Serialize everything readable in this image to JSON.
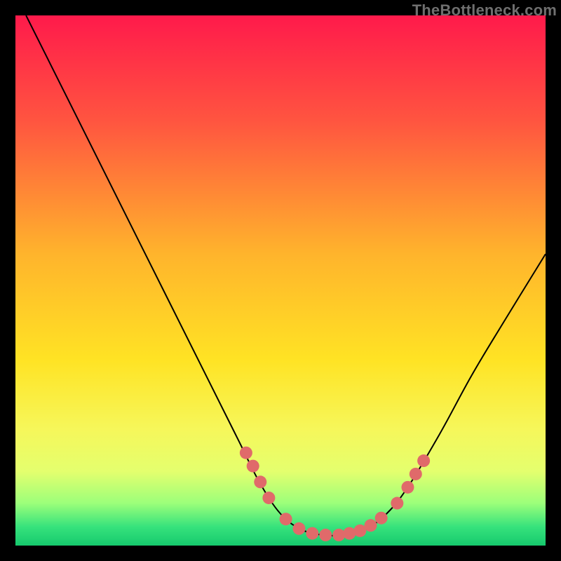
{
  "watermark": "TheBottleneck.com",
  "chart_data": {
    "type": "line",
    "title": "",
    "xlabel": "",
    "ylabel": "",
    "xlim": [
      0,
      100
    ],
    "ylim": [
      0,
      100
    ],
    "grid": false,
    "legend": false,
    "background_gradient": {
      "stops": [
        {
          "pos": 0.0,
          "color": "#ff1a4b"
        },
        {
          "pos": 0.2,
          "color": "#ff5540"
        },
        {
          "pos": 0.45,
          "color": "#ffb42c"
        },
        {
          "pos": 0.65,
          "color": "#ffe324"
        },
        {
          "pos": 0.78,
          "color": "#f6f75a"
        },
        {
          "pos": 0.86,
          "color": "#e4ff6e"
        },
        {
          "pos": 0.92,
          "color": "#9cff7a"
        },
        {
          "pos": 0.965,
          "color": "#36e27c"
        },
        {
          "pos": 1.0,
          "color": "#16c96d"
        }
      ]
    },
    "series": [
      {
        "name": "bottleneck-curve",
        "stroke": "#000000",
        "points": [
          {
            "x": 2.0,
            "y": 100.0
          },
          {
            "x": 6.0,
            "y": 92.0
          },
          {
            "x": 12.0,
            "y": 80.0
          },
          {
            "x": 20.0,
            "y": 64.0
          },
          {
            "x": 28.0,
            "y": 48.0
          },
          {
            "x": 36.0,
            "y": 32.0
          },
          {
            "x": 42.0,
            "y": 20.0
          },
          {
            "x": 46.0,
            "y": 12.0
          },
          {
            "x": 50.0,
            "y": 6.0
          },
          {
            "x": 54.0,
            "y": 3.0
          },
          {
            "x": 58.0,
            "y": 2.0
          },
          {
            "x": 62.0,
            "y": 2.0
          },
          {
            "x": 66.0,
            "y": 3.0
          },
          {
            "x": 70.0,
            "y": 6.0
          },
          {
            "x": 74.0,
            "y": 11.0
          },
          {
            "x": 80.0,
            "y": 21.0
          },
          {
            "x": 86.0,
            "y": 32.0
          },
          {
            "x": 92.0,
            "y": 42.0
          },
          {
            "x": 100.0,
            "y": 55.0
          }
        ]
      }
    ],
    "markers": {
      "name": "highlighted-points",
      "color": "#e06a6a",
      "radius_px": 9,
      "points": [
        {
          "x": 43.5,
          "y": 17.5
        },
        {
          "x": 44.8,
          "y": 15.0
        },
        {
          "x": 46.2,
          "y": 12.0
        },
        {
          "x": 47.8,
          "y": 9.0
        },
        {
          "x": 51.0,
          "y": 5.0
        },
        {
          "x": 53.5,
          "y": 3.2
        },
        {
          "x": 56.0,
          "y": 2.3
        },
        {
          "x": 58.5,
          "y": 2.0
        },
        {
          "x": 61.0,
          "y": 2.0
        },
        {
          "x": 63.0,
          "y": 2.3
        },
        {
          "x": 65.0,
          "y": 2.8
        },
        {
          "x": 67.0,
          "y": 3.8
        },
        {
          "x": 69.0,
          "y": 5.2
        },
        {
          "x": 72.0,
          "y": 8.0
        },
        {
          "x": 74.0,
          "y": 11.0
        },
        {
          "x": 75.5,
          "y": 13.5
        },
        {
          "x": 77.0,
          "y": 16.0
        }
      ]
    }
  }
}
